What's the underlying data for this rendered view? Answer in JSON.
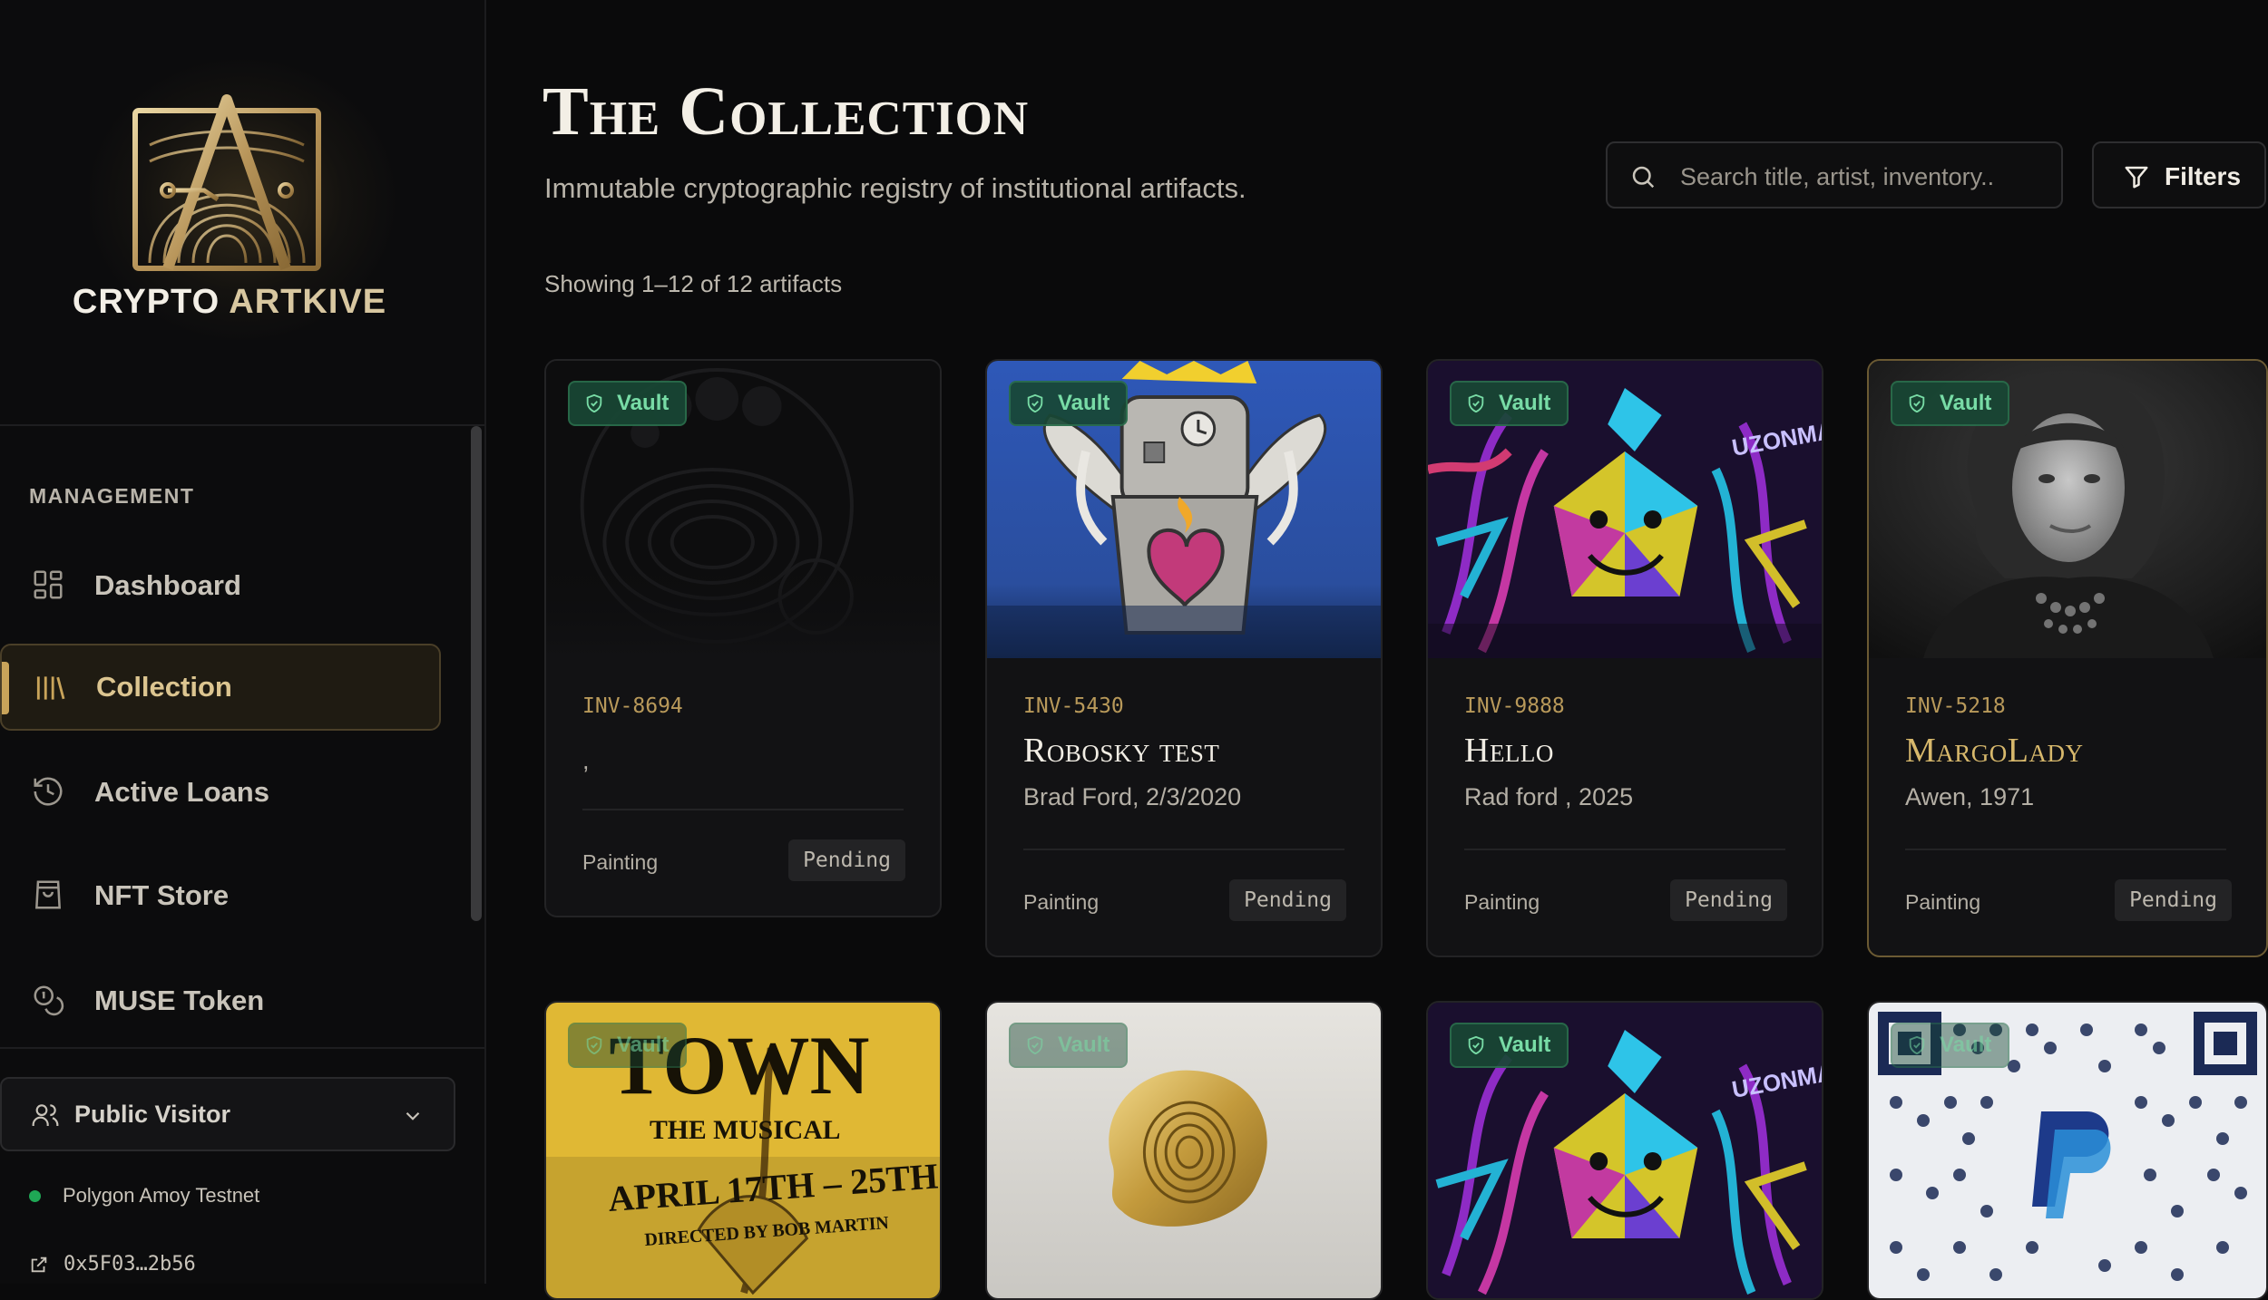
{
  "brand": {
    "name_part1": "CRYPTO ",
    "name_part2": "ARTKIVE"
  },
  "sidebar": {
    "section_label": "MANAGEMENT",
    "items": [
      {
        "label": "Dashboard",
        "icon": "grid-icon",
        "active": false
      },
      {
        "label": "Collection",
        "icon": "library-icon",
        "active": true
      },
      {
        "label": "Active Loans",
        "icon": "history-icon",
        "active": false
      },
      {
        "label": "NFT Store",
        "icon": "shopping-bag-icon",
        "active": false
      },
      {
        "label": "MUSE Token",
        "icon": "coins-icon",
        "active": false
      }
    ],
    "role_selector": "Public Visitor",
    "network": "Polygon Amoy Testnet",
    "network_status_color": "#1fa855",
    "wallet": "0x5F03…2b56"
  },
  "header": {
    "title": "The Collection",
    "subtitle": "Immutable cryptographic registry of institutional artifacts.",
    "search_placeholder": "Search title, artist, inventory..",
    "filters_label": "Filters",
    "showing": "Showing 1–12 of 12 artifacts"
  },
  "cards": [
    {
      "badge": "Vault",
      "inventory": "INV-8694",
      "title": "",
      "meta": ",",
      "type": "Painting",
      "status": "Pending"
    },
    {
      "badge": "Vault",
      "inventory": "INV-5430",
      "title": "Robosky test",
      "meta": "Brad Ford, 2/3/2020",
      "type": "Painting",
      "status": "Pending"
    },
    {
      "badge": "Vault",
      "inventory": "INV-9888",
      "title": "Hello",
      "meta": "Rad ford , 2025",
      "type": "Painting",
      "status": "Pending"
    },
    {
      "badge": "Vault",
      "inventory": "INV-5218",
      "title": "MargoLady",
      "meta": "Awen, 1971",
      "type": "Painting",
      "status": "Pending"
    },
    {
      "badge": "Vault",
      "thumb_text": [
        "TOWN",
        "THE MUSICAL",
        "APRIL 17TH – 25TH",
        "DIRECTED BY BOB MARTIN"
      ]
    },
    {
      "badge": "Vault"
    },
    {
      "badge": "Vault",
      "thumb_text": [
        "UZONMA"
      ]
    },
    {
      "badge": "Vault"
    }
  ],
  "colors": {
    "accent_gold": "#c9a45a",
    "vault_green": "#78dca6",
    "background": "#0a0a0b"
  }
}
